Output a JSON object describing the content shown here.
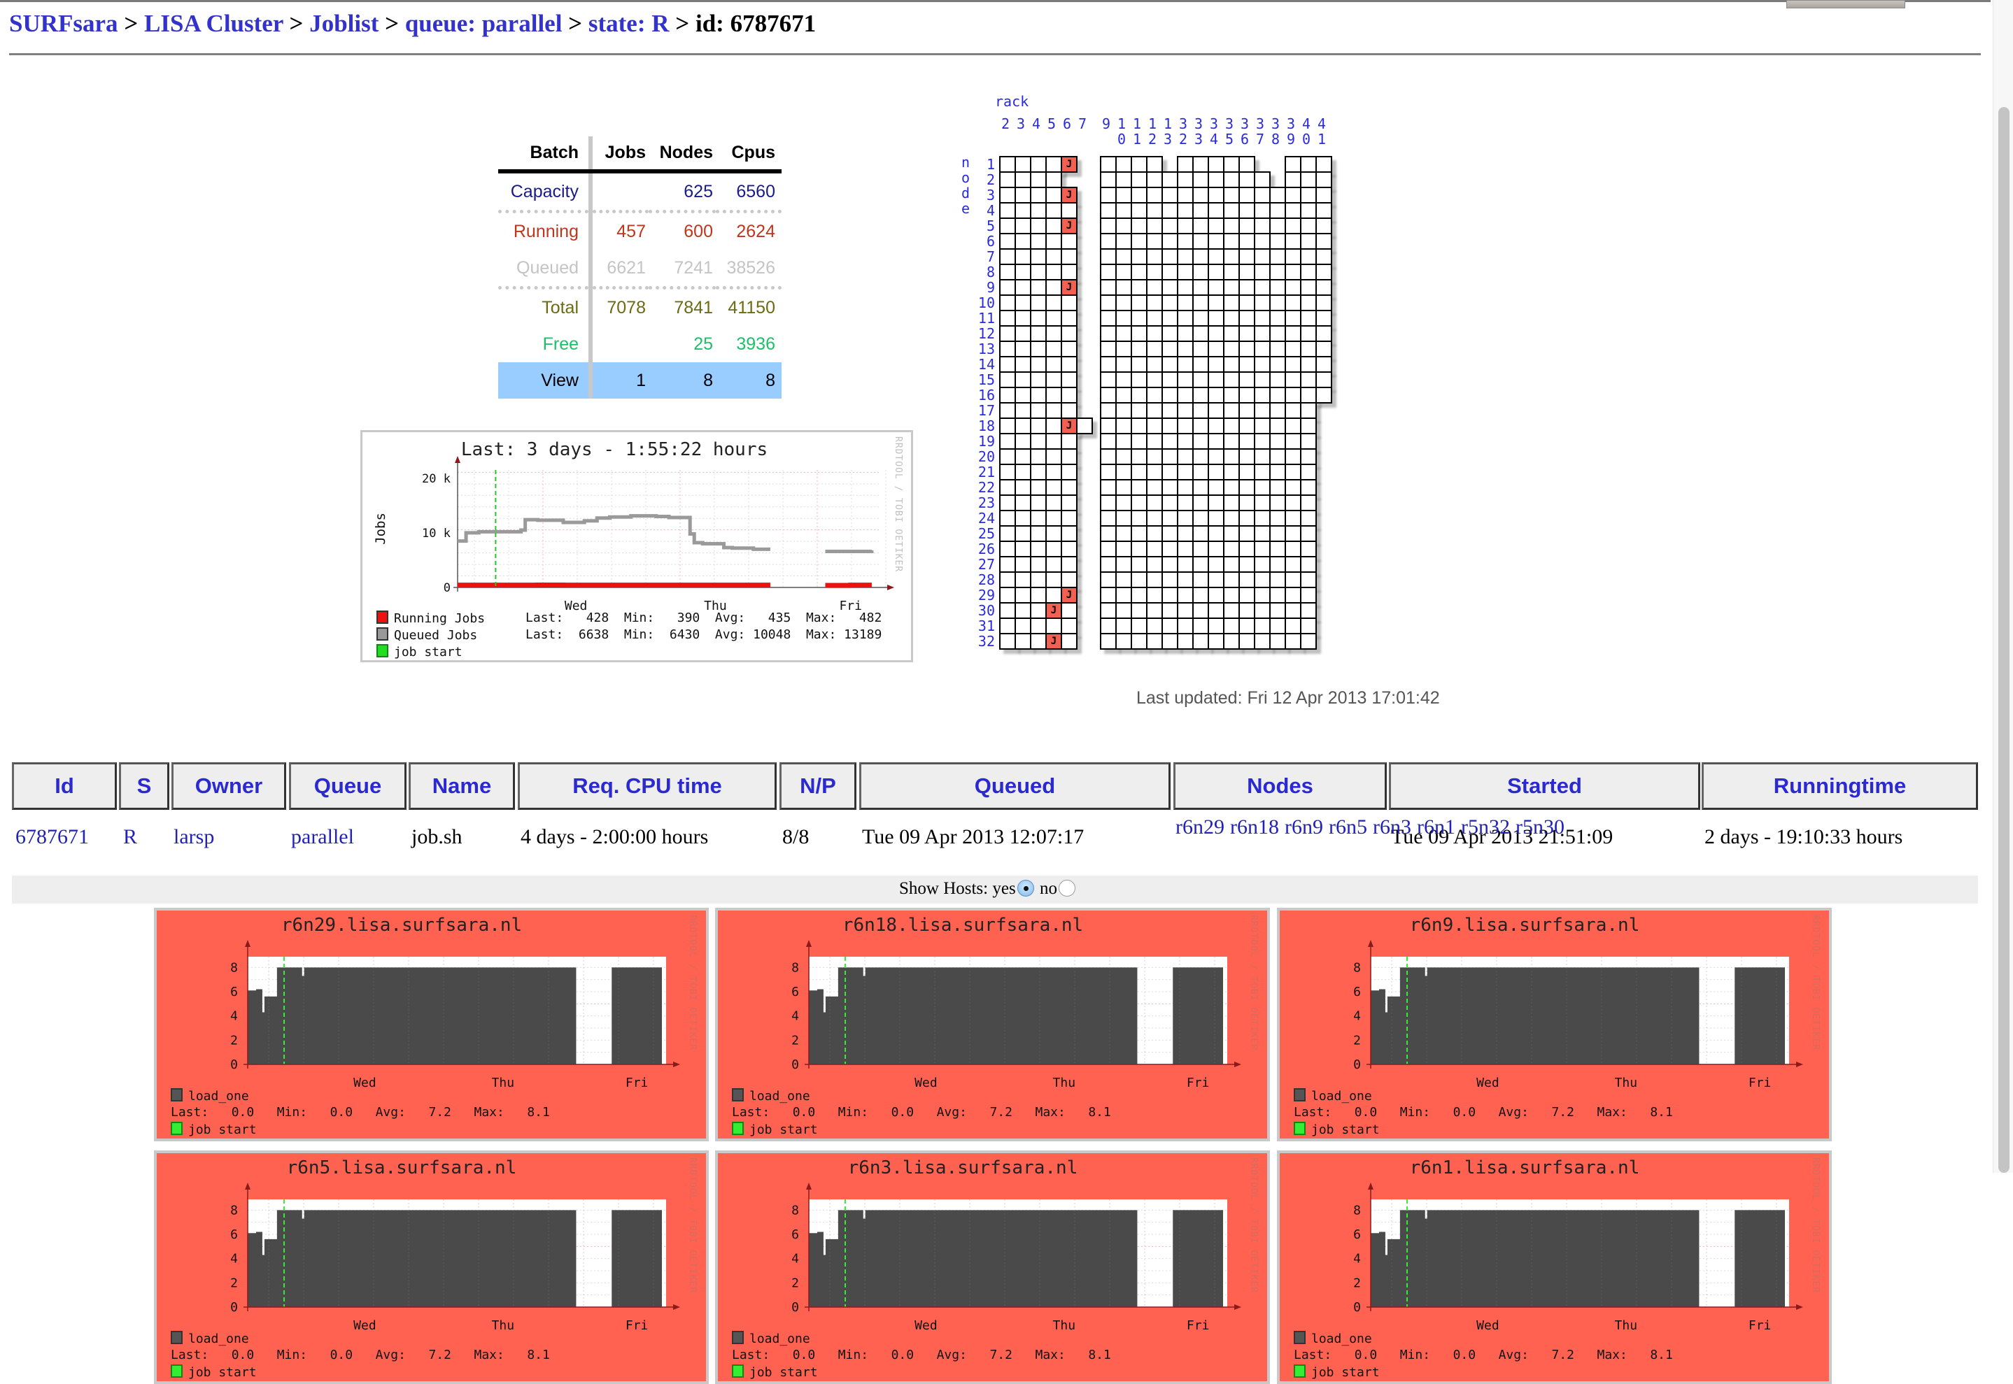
{
  "breadcrumb": {
    "items": [
      "SURFsara",
      "LISA Cluster",
      "Joblist",
      "queue: parallel",
      "state: R"
    ],
    "separator": ">",
    "current": "id: 6787671"
  },
  "batch_table": {
    "headers": [
      "Batch",
      "Jobs",
      "Nodes",
      "Cpus"
    ],
    "rows": [
      {
        "label": "Capacity",
        "jobs": "",
        "nodes": "625",
        "cpus": "6560",
        "color": "#1a1a8c"
      },
      {
        "label": "Running",
        "jobs": "457",
        "nodes": "600",
        "cpus": "2624",
        "color": "#c0361c"
      },
      {
        "label": "Queued",
        "jobs": "6621",
        "nodes": "7241",
        "cpus": "38526",
        "color": "#c4c4c4"
      },
      {
        "label": "Total",
        "jobs": "7078",
        "nodes": "7841",
        "cpus": "41150",
        "color": "#6b6b10"
      },
      {
        "label": "Free",
        "jobs": "",
        "nodes": "25",
        "cpus": "3936",
        "color": "#1fbf6a"
      },
      {
        "label": "View",
        "jobs": "1",
        "nodes": "8",
        "cpus": "8",
        "color": "#000000"
      }
    ]
  },
  "jobs_graph": {
    "title": "Last: 3 days - 1:55:22 hours",
    "ylabel": "Jobs",
    "watermark": "RRDTOOL / TOBI OETIKER",
    "yticks": [
      "0",
      "10 k",
      "20 k"
    ],
    "xticks": [
      "Wed",
      "Thu",
      "Fri"
    ],
    "legend": [
      {
        "name": "Running Jobs",
        "color": "#ee1111",
        "last": "428",
        "min": "390",
        "avg": "435",
        "max": "482"
      },
      {
        "name": "Queued Jobs",
        "color": "#999999",
        "last": "6638",
        "min": "6430",
        "avg": "10048",
        "max": "13189"
      },
      {
        "name": "job start",
        "color": "#22dd22"
      }
    ],
    "labels": {
      "last": "Last:",
      "min": "Min:",
      "avg": "Avg:",
      "max": "Max:"
    }
  },
  "chart_data": [
    {
      "type": "line",
      "title": "Last: 3 days - 1:55:22 hours",
      "ylabel": "Jobs",
      "ylim": [
        0,
        20000
      ],
      "xticks": [
        "Wed",
        "Thu",
        "Fri"
      ],
      "x_fraction": [
        0.0,
        0.02,
        0.05,
        0.1,
        0.15,
        0.16,
        0.19,
        0.25,
        0.3,
        0.33,
        0.36,
        0.41,
        0.47,
        0.5,
        0.55,
        0.56,
        0.58,
        0.63,
        0.65,
        0.7,
        0.74,
        0.78,
        0.87,
        0.93,
        0.98
      ],
      "series": [
        {
          "name": "Queued Jobs",
          "values": [
            8500,
            10000,
            10200,
            10200,
            10500,
            12400,
            12300,
            11900,
            12200,
            12700,
            12900,
            13100,
            13000,
            12800,
            9800,
            8200,
            8000,
            7300,
            7200,
            7000,
            7000,
            null,
            6600,
            6600,
            6800
          ]
        },
        {
          "name": "Running Jobs",
          "values": [
            428,
            428,
            430,
            435,
            440,
            440,
            445,
            440,
            438,
            435,
            435,
            432,
            430,
            430,
            430,
            430,
            430,
            432,
            432,
            430,
            430,
            null,
            390,
            428,
            428
          ]
        }
      ],
      "markers": [
        {
          "name": "job start",
          "x_fraction": 0.09
        }
      ],
      "legend": "bottom",
      "grid": true
    },
    {
      "type": "area",
      "title": "r6n29.lisa.surfsara.nl",
      "series_name": "load_one",
      "ylim": [
        0,
        9
      ],
      "yticks": [
        0,
        2,
        4,
        6,
        8
      ],
      "xticks": [
        "Wed",
        "Thu",
        "Fri"
      ],
      "note": "same shape on all host panels: ramps ~6 to 8, flat ~8, gap before Fri, resumes ~8",
      "stats": {
        "last": 0.0,
        "min": 0.0,
        "avg": 7.2,
        "max": 8.1
      }
    }
  ],
  "rack_map": {
    "rack_label": "rack",
    "node_label": "node",
    "rack_columns": [
      "2",
      "3",
      "4",
      "5",
      "6",
      "7",
      "9",
      "10",
      "11",
      "12",
      "13",
      "32",
      "33",
      "34",
      "35",
      "36",
      "37",
      "38",
      "39",
      "40",
      "41"
    ],
    "rows": 32,
    "job_marker": "J",
    "job_cells": [
      {
        "rack": "6",
        "node": 1
      },
      {
        "rack": "6",
        "node": 3
      },
      {
        "rack": "6",
        "node": 5
      },
      {
        "rack": "6",
        "node": 9
      },
      {
        "rack": "6",
        "node": 18
      },
      {
        "rack": "6",
        "node": 29
      },
      {
        "rack": "5",
        "node": 30
      },
      {
        "rack": "5",
        "node": 32
      }
    ]
  },
  "last_updated": "Last updated: Fri 12 Apr 2013 17:01:42",
  "job_table": {
    "headers": [
      "Id",
      "S",
      "Owner",
      "Queue",
      "Name",
      "Req. CPU time",
      "N/P",
      "Queued",
      "Nodes",
      "Started",
      "Runningtime"
    ],
    "row": {
      "id": "6787671",
      "state": "R",
      "owner": "larsp",
      "queue": "parallel",
      "name": "job.sh",
      "req_cpu_time": "4 days - 2:00:00 hours",
      "np": "8/8",
      "queued": "Tue 09 Apr 2013 12:07:17",
      "nodes": [
        "r6n29",
        "r6n18",
        "r6n9",
        "r6n5",
        "r6n3",
        "r6n1",
        "r5n32",
        "r5n30"
      ],
      "started": "Tue 09 Apr 2013 21:51:09",
      "runningtime": "2 days - 19:10:33 hours"
    }
  },
  "show_hosts": {
    "label": "Show Hosts:",
    "yes": "yes",
    "no": "no",
    "selected": "yes"
  },
  "host_graphs": {
    "series_name": "load_one",
    "watermark": "RRDTOOL / TOBI OETIKER",
    "yticks": [
      "0",
      "2",
      "4",
      "6",
      "8"
    ],
    "xticks": [
      "Wed",
      "Thu",
      "Fri"
    ],
    "job_start_label": "job start",
    "stats_line": "Last:   0.0   Min:   0.0   Avg:   7.2   Max:   8.1",
    "panel_color": "#ff6251",
    "hosts": [
      "r6n29.lisa.surfsara.nl",
      "r6n18.lisa.surfsara.nl",
      "r6n9.lisa.surfsara.nl",
      "r6n5.lisa.surfsara.nl",
      "r6n3.lisa.surfsara.nl",
      "r6n1.lisa.surfsara.nl"
    ]
  }
}
